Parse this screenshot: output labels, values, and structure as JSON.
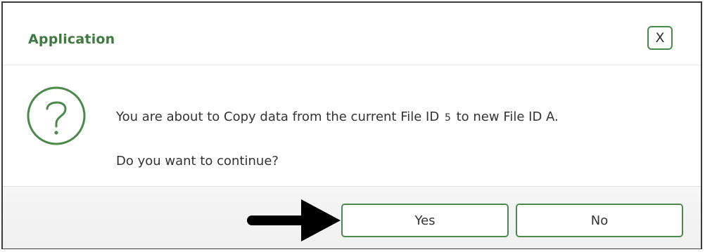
{
  "dialog": {
    "title": "Application",
    "close_label": "X",
    "message_prefix": "You are about to Copy data from the current File ID",
    "current_file_id": "5",
    "message_suffix": "to new File ID A.",
    "prompt": "Do you want to continue?",
    "yes_label": "Yes",
    "no_label": "No",
    "accent_color": "#4c8a4c",
    "icons": {
      "question": "question-circle-icon",
      "arrow": "arrow-right-icon"
    }
  }
}
